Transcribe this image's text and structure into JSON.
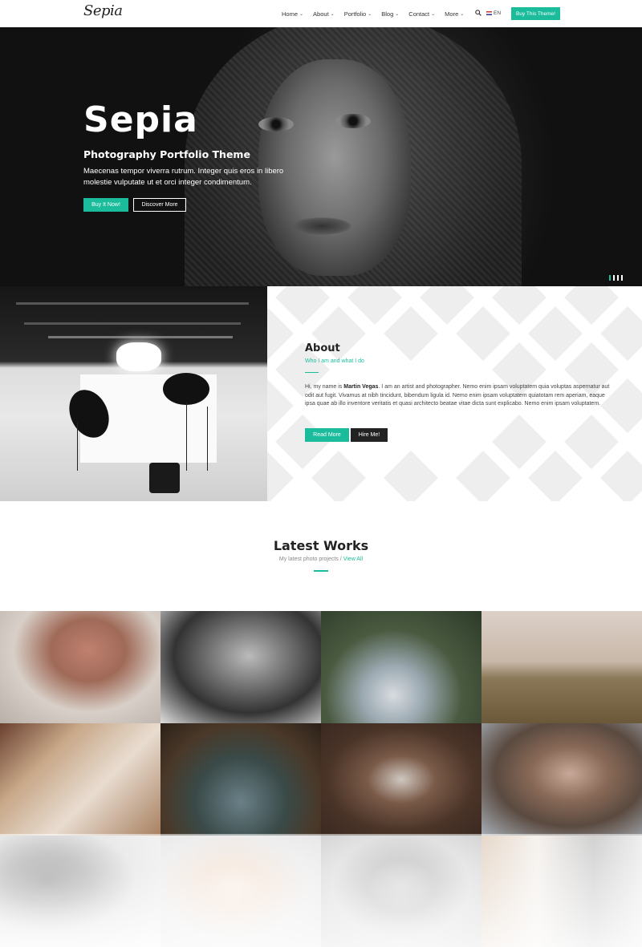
{
  "nav": {
    "logo": "Sepia",
    "items": [
      {
        "label": "Home"
      },
      {
        "label": "About"
      },
      {
        "label": "Portfolio"
      },
      {
        "label": "Blog"
      },
      {
        "label": "Contact"
      },
      {
        "label": "More"
      }
    ],
    "lang": "EN",
    "cta": "Buy This Theme!"
  },
  "hero": {
    "title": "Sepia",
    "subtitle": "Photography Portfolio Theme",
    "description": "Maecenas tempor viverra rutrum. Integer quis eros in libero molestie vulputate ut et orci integer condimentum.",
    "primary_button": "Buy It Now!",
    "secondary_button": "Discover More"
  },
  "about": {
    "title": "About",
    "subtitle": "Who I am and what I do",
    "text_before": "Hi, my name is ",
    "name": "Martin Vegas",
    "text_after": ". I am an artist and photographer. Nemo enim ipsam voluptatem quia voluptas aspernatur aut odit aut fugit. Vivamus at nibh tincidunt, bibendum ligula id. Nemo enim ipsam voluptatem quiatotam rem aperiam, eaque ipsa quae ab illo inventore veritatis et quasi architecto beatae vitae dicta sunt explicabo. Nemo enim ipsam voluptatem.",
    "read_more": "Read More",
    "hire_me": "Hire Me!"
  },
  "works": {
    "title": "Latest Works",
    "subtitle": "My latest photo projects",
    "separator": "/",
    "view_all": "View All"
  },
  "colors": {
    "accent": "#1abc9c",
    "dark": "#222222"
  }
}
